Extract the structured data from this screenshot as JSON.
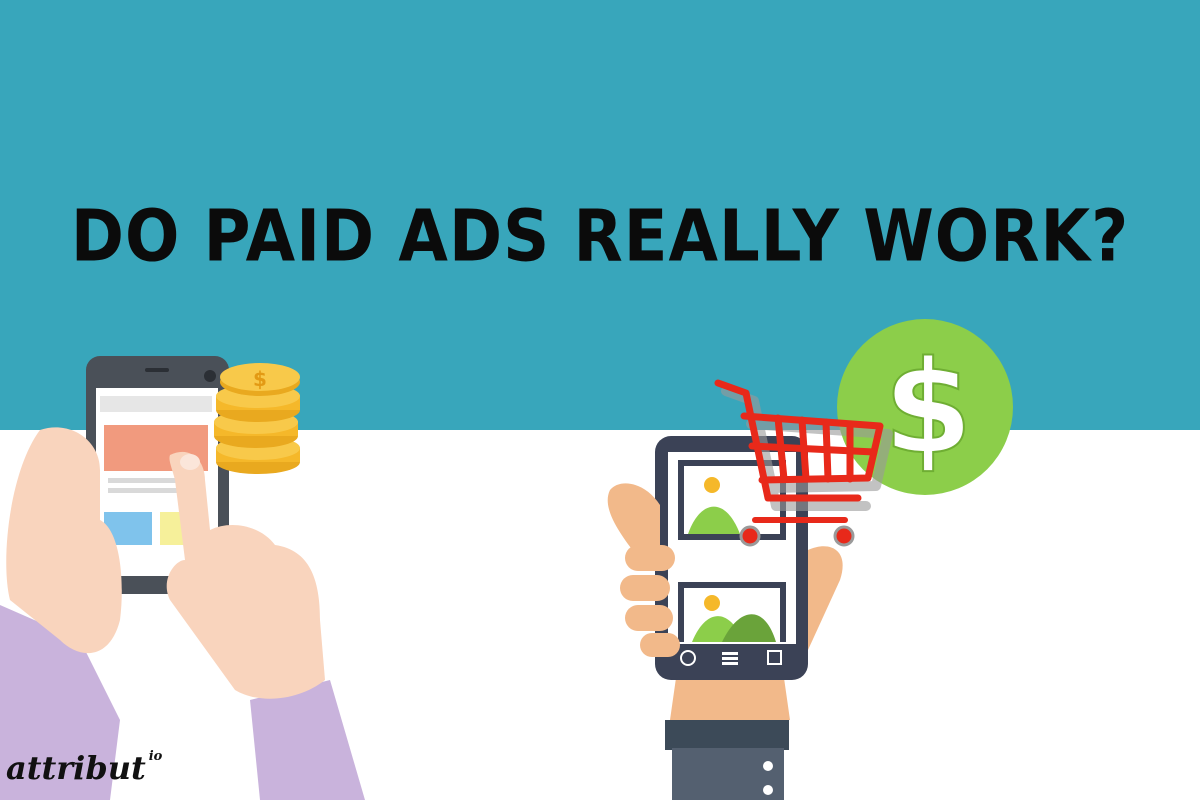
{
  "headline": "DO PAID ADS REALLY WORK?",
  "logo": {
    "name": "attribut",
    "suffix": "io"
  },
  "colors": {
    "teal_band": "#38a6bb",
    "white_band": "#ffffff",
    "green_coin": "#8cce4a",
    "cart_red": "#e8291a",
    "gold_coin": "#f5b82a",
    "phone_dark": "#3b4256",
    "skin": "#f2b98a",
    "skin_light": "#f9d4bd",
    "sleeve_purple": "#c9b3dc",
    "sleeve_gray": "#546070"
  },
  "icons": [
    "dollar-icon",
    "shopping-cart-icon",
    "coin-stack-icon",
    "image-placeholder-icon"
  ]
}
